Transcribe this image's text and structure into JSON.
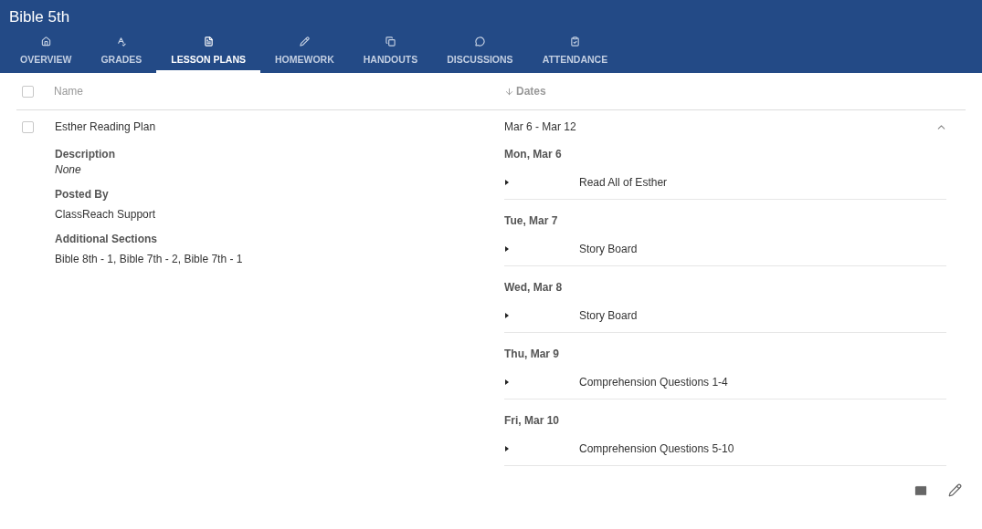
{
  "header": {
    "title": "Bible 5th"
  },
  "tabs": [
    {
      "label": "OVERVIEW",
      "selected": false
    },
    {
      "label": "GRADES",
      "selected": false
    },
    {
      "label": "LESSON PLANS",
      "selected": true
    },
    {
      "label": "HOMEWORK",
      "selected": false
    },
    {
      "label": "HANDOUTS",
      "selected": false
    },
    {
      "label": "DISCUSSIONS",
      "selected": false
    },
    {
      "label": "ATTENDANCE",
      "selected": false
    }
  ],
  "table": {
    "columns": [
      "Name",
      "Dates"
    ],
    "select_all_checked": false,
    "rows": [
      {
        "name": "Esther Reading Plan",
        "dates": "Mar 6 - Mar 12",
        "checked": false,
        "expanded": true,
        "details": [
          {
            "label": "Description",
            "value": "None",
            "italic": true
          },
          {
            "label": "Posted By",
            "value": "ClassReach Support",
            "italic": false
          },
          {
            "label": "Additional Sections",
            "value": "Bible 8th - 1, Bible 7th - 2, Bible 7th - 1",
            "italic": false
          }
        ],
        "days": [
          {
            "day": "Mon, Mar 6",
            "items": [
              "Read All of Esther"
            ]
          },
          {
            "day": "Tue, Mar 7",
            "items": [
              "Story Board"
            ]
          },
          {
            "day": "Wed, Mar 8",
            "items": [
              "Story Board"
            ]
          },
          {
            "day": "Thu, Mar 9",
            "items": [
              "Comprehension Questions 1-4"
            ]
          },
          {
            "day": "Fri, Mar 10",
            "items": [
              "Comprehension Questions 5-10"
            ]
          }
        ]
      }
    ]
  }
}
